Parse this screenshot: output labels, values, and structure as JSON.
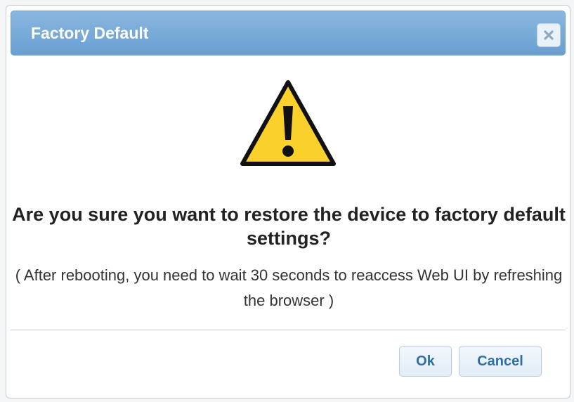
{
  "dialog": {
    "title": "Factory Default",
    "close_icon": "close-icon",
    "warning_icon": "warning-triangle-icon",
    "question": "Are you sure you want to restore the device to factory default settings?",
    "note": "( After rebooting, you need to wait 30 seconds to reaccess Web UI by refreshing the browser )",
    "buttons": {
      "ok_label": "Ok",
      "cancel_label": "Cancel"
    }
  },
  "colors": {
    "titlebar": "#7aaddb",
    "warning_fill": "#f9d12a",
    "button_text": "#2f6fa8"
  }
}
